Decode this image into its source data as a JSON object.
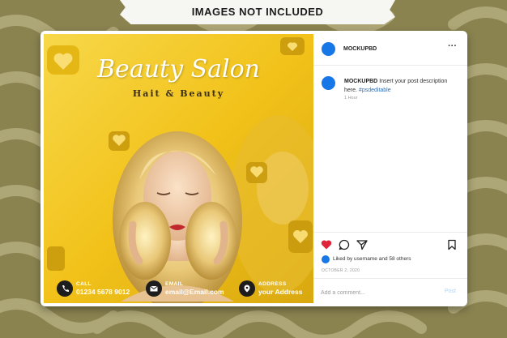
{
  "banner": {
    "text": "IMAGES NOT INCLUDED"
  },
  "post": {
    "script_title": "Beauty Salon",
    "sub_title": "Hait & Beauty",
    "contacts": [
      {
        "label": "CALL",
        "value": "01234 5678 9012",
        "icon": "phone-icon"
      },
      {
        "label": "EMAIL",
        "value": "email@Email.com",
        "icon": "mail-icon"
      },
      {
        "label": "ADDRESS",
        "value": "your Address",
        "icon": "location-icon"
      }
    ]
  },
  "panel": {
    "header_username": "MOCKUPBD",
    "comment": {
      "username": "MOCKUPBD",
      "text": "Insert your post description here.",
      "hashtag": "#psdeditable",
      "time": "1 Hour"
    },
    "liked_by": "Liked by username and 58 others",
    "date": "OCTOBER 2, 2020",
    "comment_placeholder": "Add a comment...",
    "post_label": "Post"
  },
  "colors": {
    "background": "#8a8350",
    "accent_yellow": "#f2c21a",
    "avatar_blue": "#1877e6",
    "like_red": "#e0243a"
  }
}
